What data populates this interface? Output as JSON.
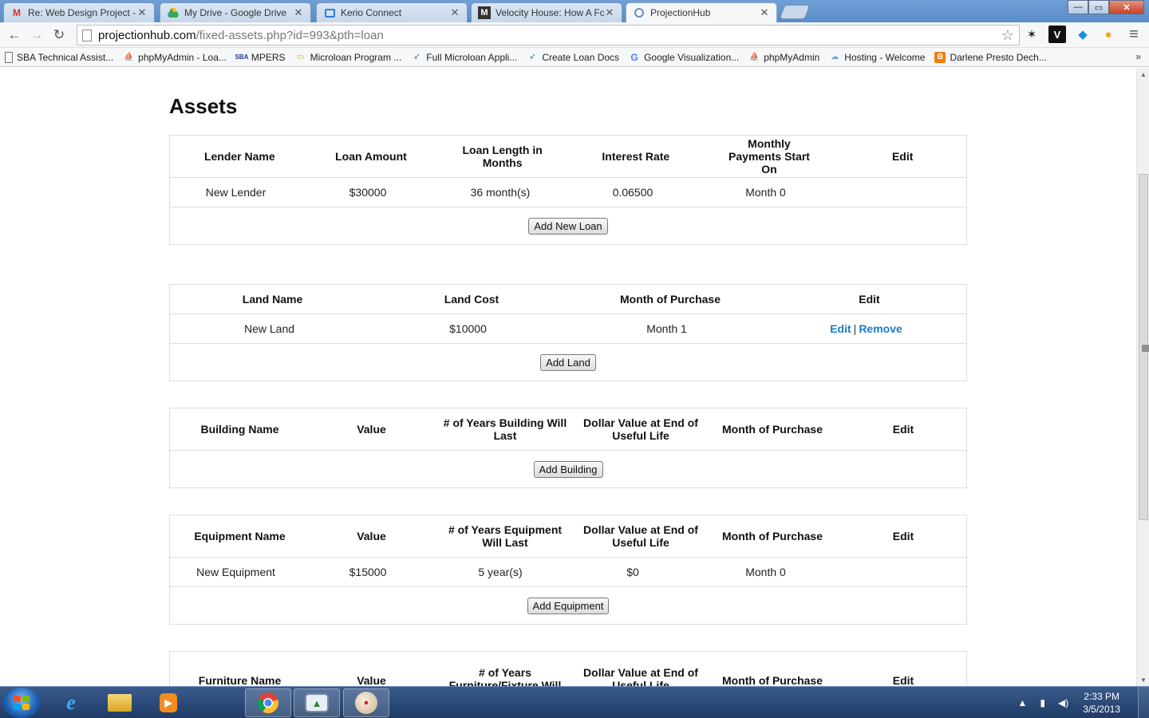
{
  "browser": {
    "tabs": [
      {
        "title": "Re: Web Design Project - a",
        "icon": "gmail-icon",
        "active": false
      },
      {
        "title": "My Drive - Google Drive",
        "icon": "google-drive-icon",
        "active": false
      },
      {
        "title": "Kerio Connect",
        "icon": "kerio-icon",
        "active": false
      },
      {
        "title": "Velocity House: How A Fo",
        "icon": "velocity-icon",
        "active": false
      },
      {
        "title": "ProjectionHub",
        "icon": "projectionhub-icon",
        "active": true
      }
    ],
    "url_host": "projectionhub.com",
    "url_path": "/fixed-assets.php?id=993&pth=loan",
    "bookmarks": [
      "SBA Technical Assist...",
      "phpMyAdmin - Loa...",
      "MPERS",
      "Microloan Program ...",
      "Full Microloan Appli...",
      "Create Loan Docs",
      "Google Visualization...",
      "phpMyAdmin",
      "Hosting - Welcome",
      "Darlene Presto Dech..."
    ],
    "bookmarks_more": "»",
    "glyphs": {
      "back": "←",
      "forward": "→",
      "reload": "↻",
      "star": "☆",
      "menu": "≡",
      "tab_close": "✕",
      "minimize": "—",
      "maximize": "▭",
      "close": "✕",
      "scroll_up": "▲",
      "scroll_down": "▼"
    }
  },
  "page": {
    "title": "Assets",
    "loans": {
      "headers": [
        "Lender Name",
        "Loan Amount",
        "Loan Length in Months",
        "Interest Rate",
        "Monthly Payments Start On",
        "Edit"
      ],
      "rows": [
        [
          "New Lender",
          "$30000",
          "36 month(s)",
          "0.06500",
          "Month 0",
          ""
        ]
      ],
      "add_button": "Add New Loan"
    },
    "land": {
      "headers": [
        "Land Name",
        "Land Cost",
        "Month of Purchase",
        "Edit"
      ],
      "rows": [
        [
          "New Land",
          "$10000",
          "Month 1"
        ]
      ],
      "edit_link": "Edit",
      "separator": "|",
      "remove_link": "Remove",
      "add_button": "Add Land"
    },
    "buildings": {
      "headers": [
        "Building Name",
        "Value",
        "# of Years Building Will Last",
        "Dollar Value at End of Useful Life",
        "Month of Purchase",
        "Edit"
      ],
      "rows": [],
      "add_button": "Add Building"
    },
    "equipment": {
      "headers": [
        "Equipment Name",
        "Value",
        "# of Years Equipment Will Last",
        "Dollar Value at End of Useful Life",
        "Month of Purchase",
        "Edit"
      ],
      "rows": [
        [
          "New Equipment",
          "$15000",
          "5 year(s)",
          "$0",
          "Month 0",
          ""
        ]
      ],
      "add_button": "Add Equipment"
    },
    "furniture": {
      "headers": [
        "Furniture Name",
        "Value",
        "# of Years Furniture/Fixture Will",
        "Dollar Value at End of Useful Life",
        "Month of Purchase",
        "Edit"
      ]
    }
  },
  "taskbar": {
    "time": "2:33 PM",
    "date": "3/5/2013",
    "apps": [
      "internet-explorer-icon",
      "file-explorer-icon",
      "media-player-icon",
      "control-panel-icon",
      "chrome-icon",
      "presentation-app-icon",
      "paint-icon"
    ]
  },
  "colors": {
    "link": "#1a7cc7",
    "border": "#dddddd",
    "taskbar": "#1f3b66"
  }
}
